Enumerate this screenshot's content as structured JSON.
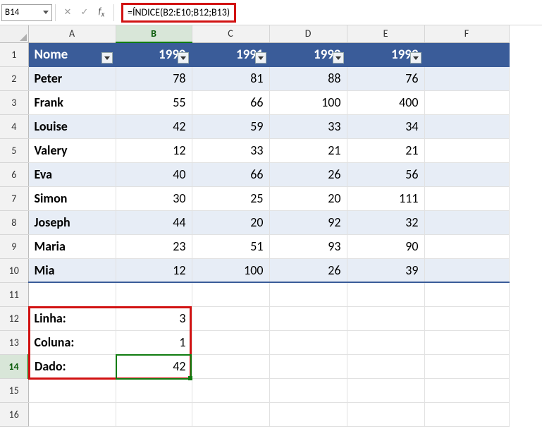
{
  "activeCellRef": "B14",
  "formula": "=ÍNDICE(B2:E10;B12;B13)",
  "columns": [
    "A",
    "B",
    "C",
    "D",
    "E",
    "F"
  ],
  "rowCount": 16,
  "tableHeader": {
    "name": "Nome",
    "y1": "1990",
    "y2": "1991",
    "y3": "1992",
    "y4": "1993"
  },
  "rows": [
    {
      "name": "Peter",
      "v": [
        78,
        81,
        88,
        76
      ]
    },
    {
      "name": "Frank",
      "v": [
        55,
        66,
        100,
        400
      ]
    },
    {
      "name": "Louise",
      "v": [
        42,
        59,
        33,
        34
      ]
    },
    {
      "name": "Valery",
      "v": [
        12,
        33,
        21,
        21
      ]
    },
    {
      "name": "Eva",
      "v": [
        40,
        66,
        26,
        56
      ]
    },
    {
      "name": "Simon",
      "v": [
        30,
        25,
        20,
        111
      ]
    },
    {
      "name": "Joseph",
      "v": [
        44,
        20,
        92,
        32
      ]
    },
    {
      "name": "Maria",
      "v": [
        23,
        51,
        93,
        90
      ]
    },
    {
      "name": "Mia",
      "v": [
        12,
        100,
        26,
        39
      ]
    }
  ],
  "lookup": {
    "linhaLabel": "Linha:",
    "linhaVal": 3,
    "colunaLabel": "Coluna:",
    "colunaVal": 1,
    "dadoLabel": "Dado:",
    "dadoVal": 42
  }
}
